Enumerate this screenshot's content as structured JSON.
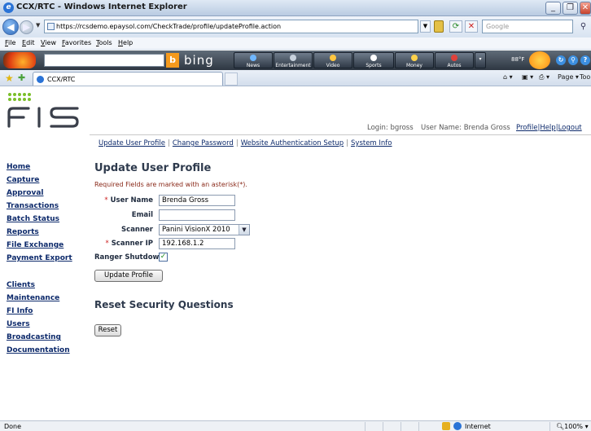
{
  "window": {
    "title": "CCX/RTC - Windows Internet Explorer",
    "controls": [
      "_",
      "❐",
      "✕"
    ]
  },
  "address_bar": {
    "url": "https://rcsdemo.epaysol.com/CheckTrade/profile/updateProfile.action",
    "search_placeholder": "Google"
  },
  "menu": [
    "File",
    "Edit",
    "View",
    "Favorites",
    "Tools",
    "Help"
  ],
  "bing_bar": {
    "logo": "bing",
    "buttons": [
      "News",
      "Entertainment",
      "Video",
      "Sports",
      "Money",
      "Autos"
    ],
    "temperature": "88°F"
  },
  "favorites_bar": {
    "tab_title": "CCX/RTC",
    "commands": [
      "Page ▾",
      "Tools ▾"
    ]
  },
  "header": {
    "login": "Login: bgross",
    "user_name": "User Name: Brenda Gross",
    "links": [
      "Profile",
      "Help",
      "Logout"
    ],
    "separator": "|"
  },
  "sub_nav": [
    "Update User Profile",
    "Change Password",
    "Website Authentication Setup",
    "System Info"
  ],
  "sidebar": {
    "items": [
      "Home",
      "Capture",
      "Approval",
      "Transactions",
      "Batch Status",
      "Reports",
      "File Exchange",
      "Payment Export",
      "Clients",
      "Maintenance",
      "FI Info",
      "Users",
      "Broadcasting",
      "Documentation"
    ]
  },
  "form": {
    "title": "Update User Profile",
    "note": "Required Fields are marked with an asterisk(*).",
    "asterisk": "*",
    "user_name_label": "User Name",
    "user_name_value": "Brenda Gross",
    "email_label": "Email",
    "email_value": "",
    "scanner_label": "Scanner",
    "scanner_value": "Panini VisionX 2010",
    "scanner_ip_label": "Scanner IP",
    "scanner_ip_value": "192.168.1.2",
    "ranger_shutdown_label": "Ranger Shutdown",
    "ranger_shutdown_checked": true,
    "submit_label": "Update Profile"
  },
  "security": {
    "title": "Reset Security Questions",
    "reset_label": "Reset"
  },
  "status_bar": {
    "status": "Done",
    "zone": "Internet",
    "zoom": "100%"
  },
  "colors": {
    "link": "#0d2a6b",
    "heading": "#2e3a4d",
    "asterisk": "#cc2020"
  }
}
